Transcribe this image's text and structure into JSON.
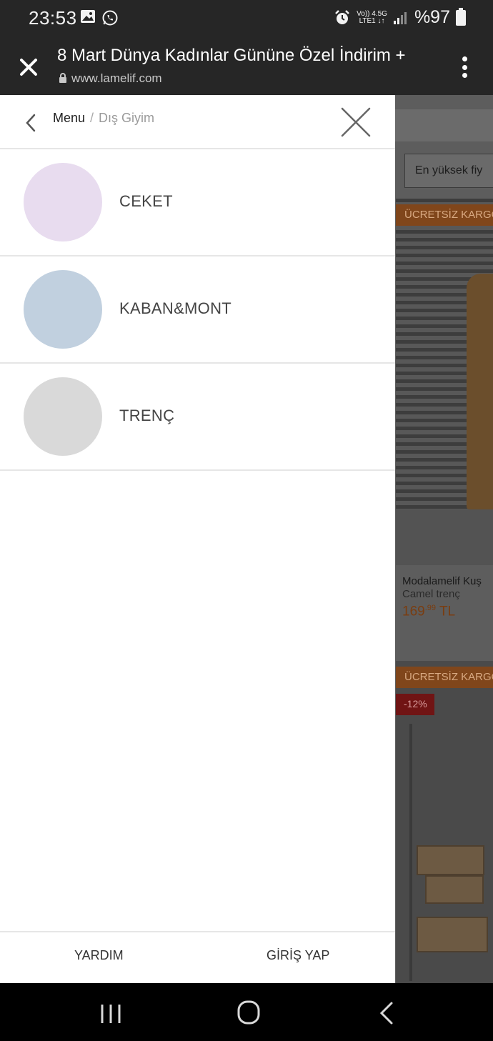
{
  "status_bar": {
    "time": "23:53",
    "network_top": "Vo)) 4.5G",
    "network_bottom": "LTE1 ↓↑",
    "battery": "%97",
    "left_icons": [
      "gallery-icon",
      "whatsapp-icon"
    ],
    "right_icons": [
      "alarm-icon",
      "signal-icon",
      "battery-icon"
    ]
  },
  "browser": {
    "page_title": "8 Mart Dünya Kadınlar Gününe Özel İndirim +",
    "url": "www.lamelif.com"
  },
  "drawer": {
    "breadcrumb_root": "Menu",
    "breadcrumb_separator": "/",
    "breadcrumb_current": "Dış Giyim",
    "categories": [
      {
        "label": "CEKET",
        "color": "#e8dcef"
      },
      {
        "label": "KABAN&MONT",
        "color": "#c1d0df"
      },
      {
        "label": "TRENÇ",
        "color": "#d9d9d9"
      }
    ],
    "footer": {
      "help": "YARDIM",
      "login": "GİRİŞ YAP"
    }
  },
  "background_page": {
    "sort_label": "En yüksek fiy",
    "badge_free_shipping": "ÜCRETSİZ KARGO",
    "product_name": "Modalamelif Kuş",
    "product_sub": "Camel trenç",
    "product_price_int": "169",
    "product_price_dec": ".99",
    "product_currency": "TL",
    "discount": "-12%"
  },
  "colors": {
    "bar_bg": "#262626",
    "divider": "#e6e6e6",
    "overlay_page": "#5d5d5d",
    "nav_bg": "#000000"
  }
}
